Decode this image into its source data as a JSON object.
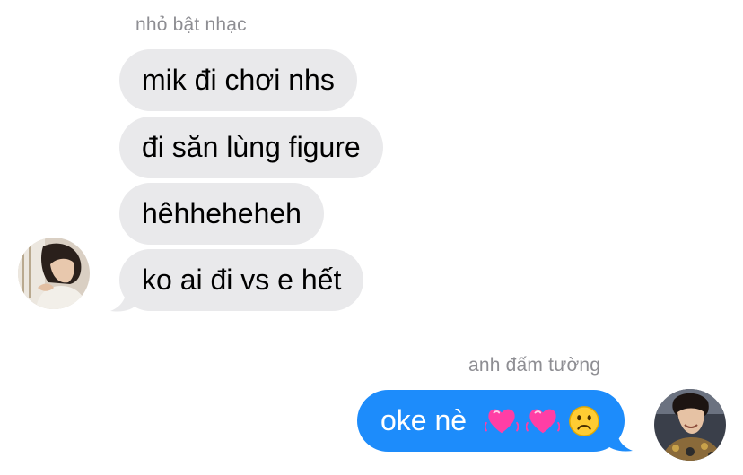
{
  "conversation": {
    "incoming_sender": "nhỏ bật nhạc",
    "incoming_messages": [
      "mik đi chơi nhs",
      "đi săn lùng figure",
      "hêhheheheh",
      "ko ai đi vs e hết"
    ],
    "outgoing_sender": "anh đấm tường",
    "outgoing_message": {
      "text": "oke nè",
      "emojis": [
        "pink-heart-icon",
        "pink-heart-icon",
        "sad-face-icon"
      ]
    }
  },
  "colors": {
    "incoming_bubble": "#e9e9eb",
    "outgoing_bubble": "#1d8cfb",
    "sender_name": "#8e8e93",
    "heart": "#ff3ea5",
    "sad_face": "#ffcc33"
  }
}
